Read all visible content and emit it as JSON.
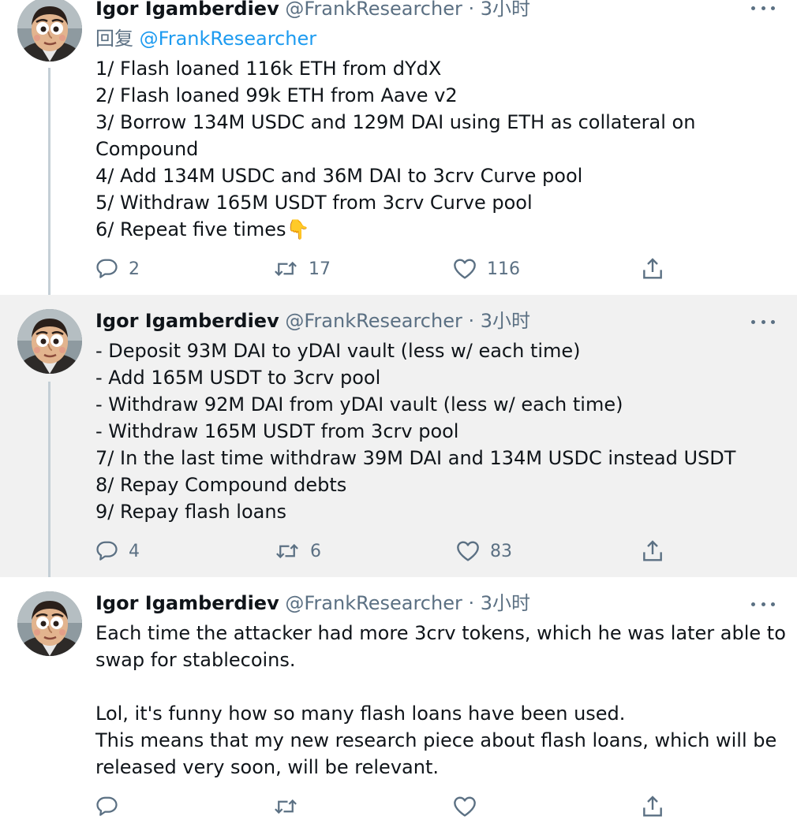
{
  "tweets": [
    {
      "name": "Igor Igamberdiev",
      "handle": "@FrankResearcher",
      "sep": "·",
      "time": "3小时",
      "reply_to_kw": "回复",
      "reply_to": "@FrankResearcher",
      "lines": [
        "1/ Flash loaned 116k ETH from dYdX",
        "2/ Flash loaned 99k ETH from Aave v2",
        "3/ Borrow 134M USDC and 129M DAI using ETH as collateral on",
        "Compound",
        "4/ Add 134M USDC and 36M DAI to 3crv Curve pool",
        "5/ Withdraw 165M USDT from 3crv Curve pool",
        "6/ Repeat five times"
      ],
      "emoji": "👇",
      "replies": "2",
      "retweets": "17",
      "likes": "116"
    },
    {
      "name": "Igor Igamberdiev",
      "handle": "@FrankResearcher",
      "sep": "·",
      "time": "3小时",
      "lines": [
        "- Deposit 93M DAI to yDAI vault (less w/ each time)",
        "- Add 165M USDT to 3crv pool",
        "- Withdraw 92M DAI from yDAI vault (less w/ each time)",
        "- Withdraw 165M USDT from 3crv pool",
        "7/ In the last time withdraw 39M DAI and 134M USDC instead USDT",
        "8/ Repay Compound debts",
        "9/ Repay flash loans"
      ],
      "replies": "4",
      "retweets": "6",
      "likes": "83"
    },
    {
      "name": "Igor Igamberdiev",
      "handle": "@FrankResearcher",
      "sep": "·",
      "time": "3小时",
      "lines": [
        "Each time the attacker had more 3crv tokens, which he was later able to",
        "swap for stablecoins.",
        "",
        "Lol, it's funny how so many flash loans have been used.",
        "This means that my new research piece about flash loans, which will be",
        "released very soon, will be relevant."
      ]
    }
  ],
  "icons": {
    "reply": "reply-icon",
    "retweet": "retweet-icon",
    "like": "heart-icon",
    "share": "share-icon",
    "more": "more-icon"
  },
  "colors": {
    "text": "#0f1419",
    "muted": "#5b7083",
    "link": "#1d9bf0",
    "highlight_bg": "#f1f1f1",
    "thread_line": "#c4cfd6"
  }
}
